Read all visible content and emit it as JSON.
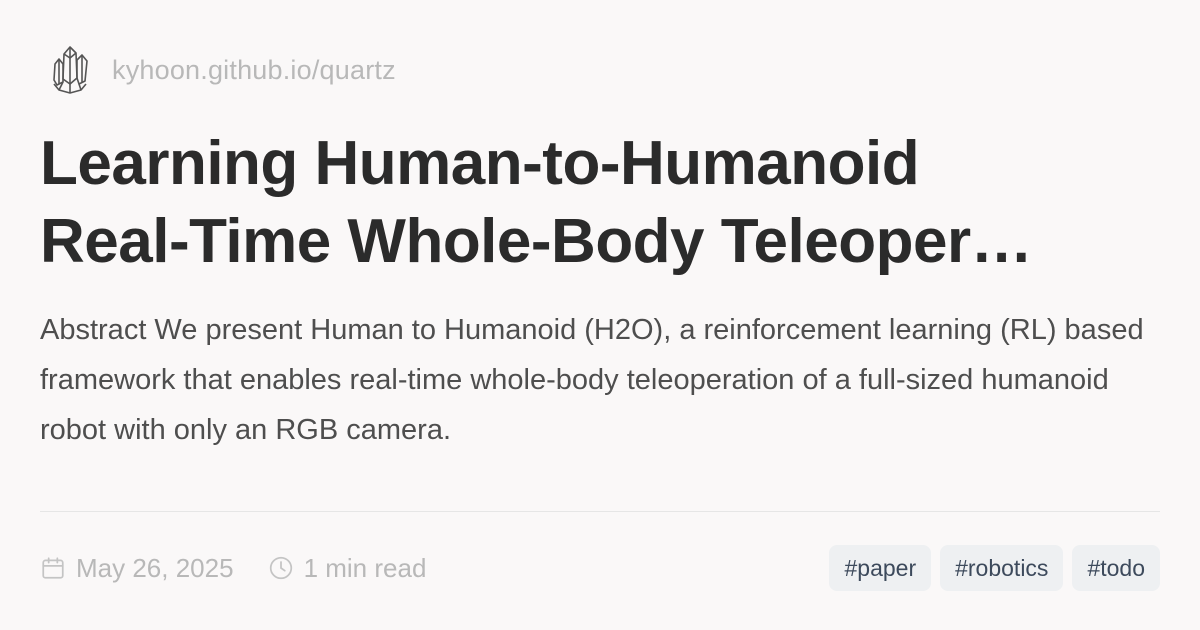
{
  "site": {
    "url": "kyhoon.github.io/quartz",
    "logo_icon": "crystal-cluster-icon"
  },
  "post": {
    "title_line_1": "Learning Human-to-Humanoid",
    "title_line_2": "Real-Time Whole-Body Teleoper…",
    "description": "Abstract We present Human to Humanoid (H2O), a reinforcement learning (RL) based framework that enables real-time whole-body teleoperation of a full-sized humanoid robot with only an RGB camera.",
    "date": "May 26, 2025",
    "date_icon": "calendar-icon",
    "reading_time": "1 min read",
    "reading_time_icon": "clock-icon",
    "tags": [
      "#paper",
      "#robotics",
      "#todo"
    ]
  },
  "colors": {
    "background": "#faf8f8",
    "title": "#2b2b2b",
    "body_text": "#4e4e4e",
    "muted": "#b8b8b8",
    "tag_bg": "#eef0f2",
    "tag_text": "#3d4a5c"
  }
}
